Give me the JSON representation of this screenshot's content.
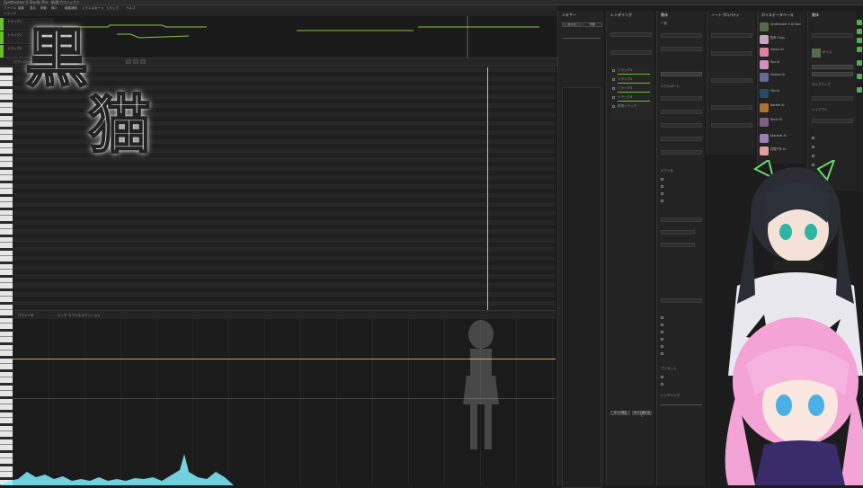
{
  "window": {
    "title": "Synthesizer V Studio Pro - 新規プロジェクト"
  },
  "menu": [
    "ファイル",
    "編集",
    "表示",
    "移動",
    "挿入",
    "編集補助",
    "トランスポート",
    "トラック",
    "ヘルプ"
  ],
  "overlay_text": {
    "line1": "黒",
    "line2": "猫"
  },
  "arrangement": {
    "label": "トラック",
    "tracks": [
      {
        "name": "トラック1"
      },
      {
        "name": "トラック2"
      },
      {
        "name": "トラック3"
      }
    ]
  },
  "pianoroll": {
    "label": "ピアノロール"
  },
  "parameters": {
    "label": "パラメータ",
    "tabs": [
      "ピッチ",
      "ラウドネス",
      "テンション",
      "ブレス",
      "ボイシング",
      "ジェンダー"
    ]
  },
  "panels": {
    "mixer": {
      "title": "ミキサー",
      "tabs": [
        "ボイス",
        "外部"
      ]
    },
    "rendering": {
      "title": "レンダリング",
      "items": [
        "トラック1",
        "トラック2",
        "トラック3",
        "トラック4",
        "新規トラック"
      ],
      "buttons": [
        "すべて再生",
        "すべて書き出し"
      ]
    },
    "inspector": {
      "title": "書体",
      "sections": [
        "一般",
        "エクスポート",
        "スナップ",
        "エディタ",
        "ゲイン",
        "プリセット",
        "レンダリング"
      ]
    },
    "note_props": {
      "title": "ノートプロパティ"
    },
    "voice_db": {
      "title": "ボイスデータベース",
      "items": [
        {
          "name": "Synthesizer V AI Saki"
        },
        {
          "name": "知声 Chiyu"
        },
        {
          "name": "Genbu AI"
        },
        {
          "name": "Ryo AI"
        },
        {
          "name": "Eleanor AI"
        },
        {
          "name": "Mai AI"
        },
        {
          "name": "Natalie AI"
        },
        {
          "name": "Kevin AI"
        },
        {
          "name": "Stardust AI"
        },
        {
          "name": "花隈千冬 AI"
        }
      ]
    },
    "output": {
      "title": "書体",
      "labels": [
        "ボイス",
        "サンプリング",
        "レイアウト",
        "エクスポート"
      ]
    }
  },
  "colors": {
    "accent": "#6abf2c",
    "bg": "#1c1c1c",
    "panel": "#232323",
    "wave": "#7ff0ff"
  }
}
